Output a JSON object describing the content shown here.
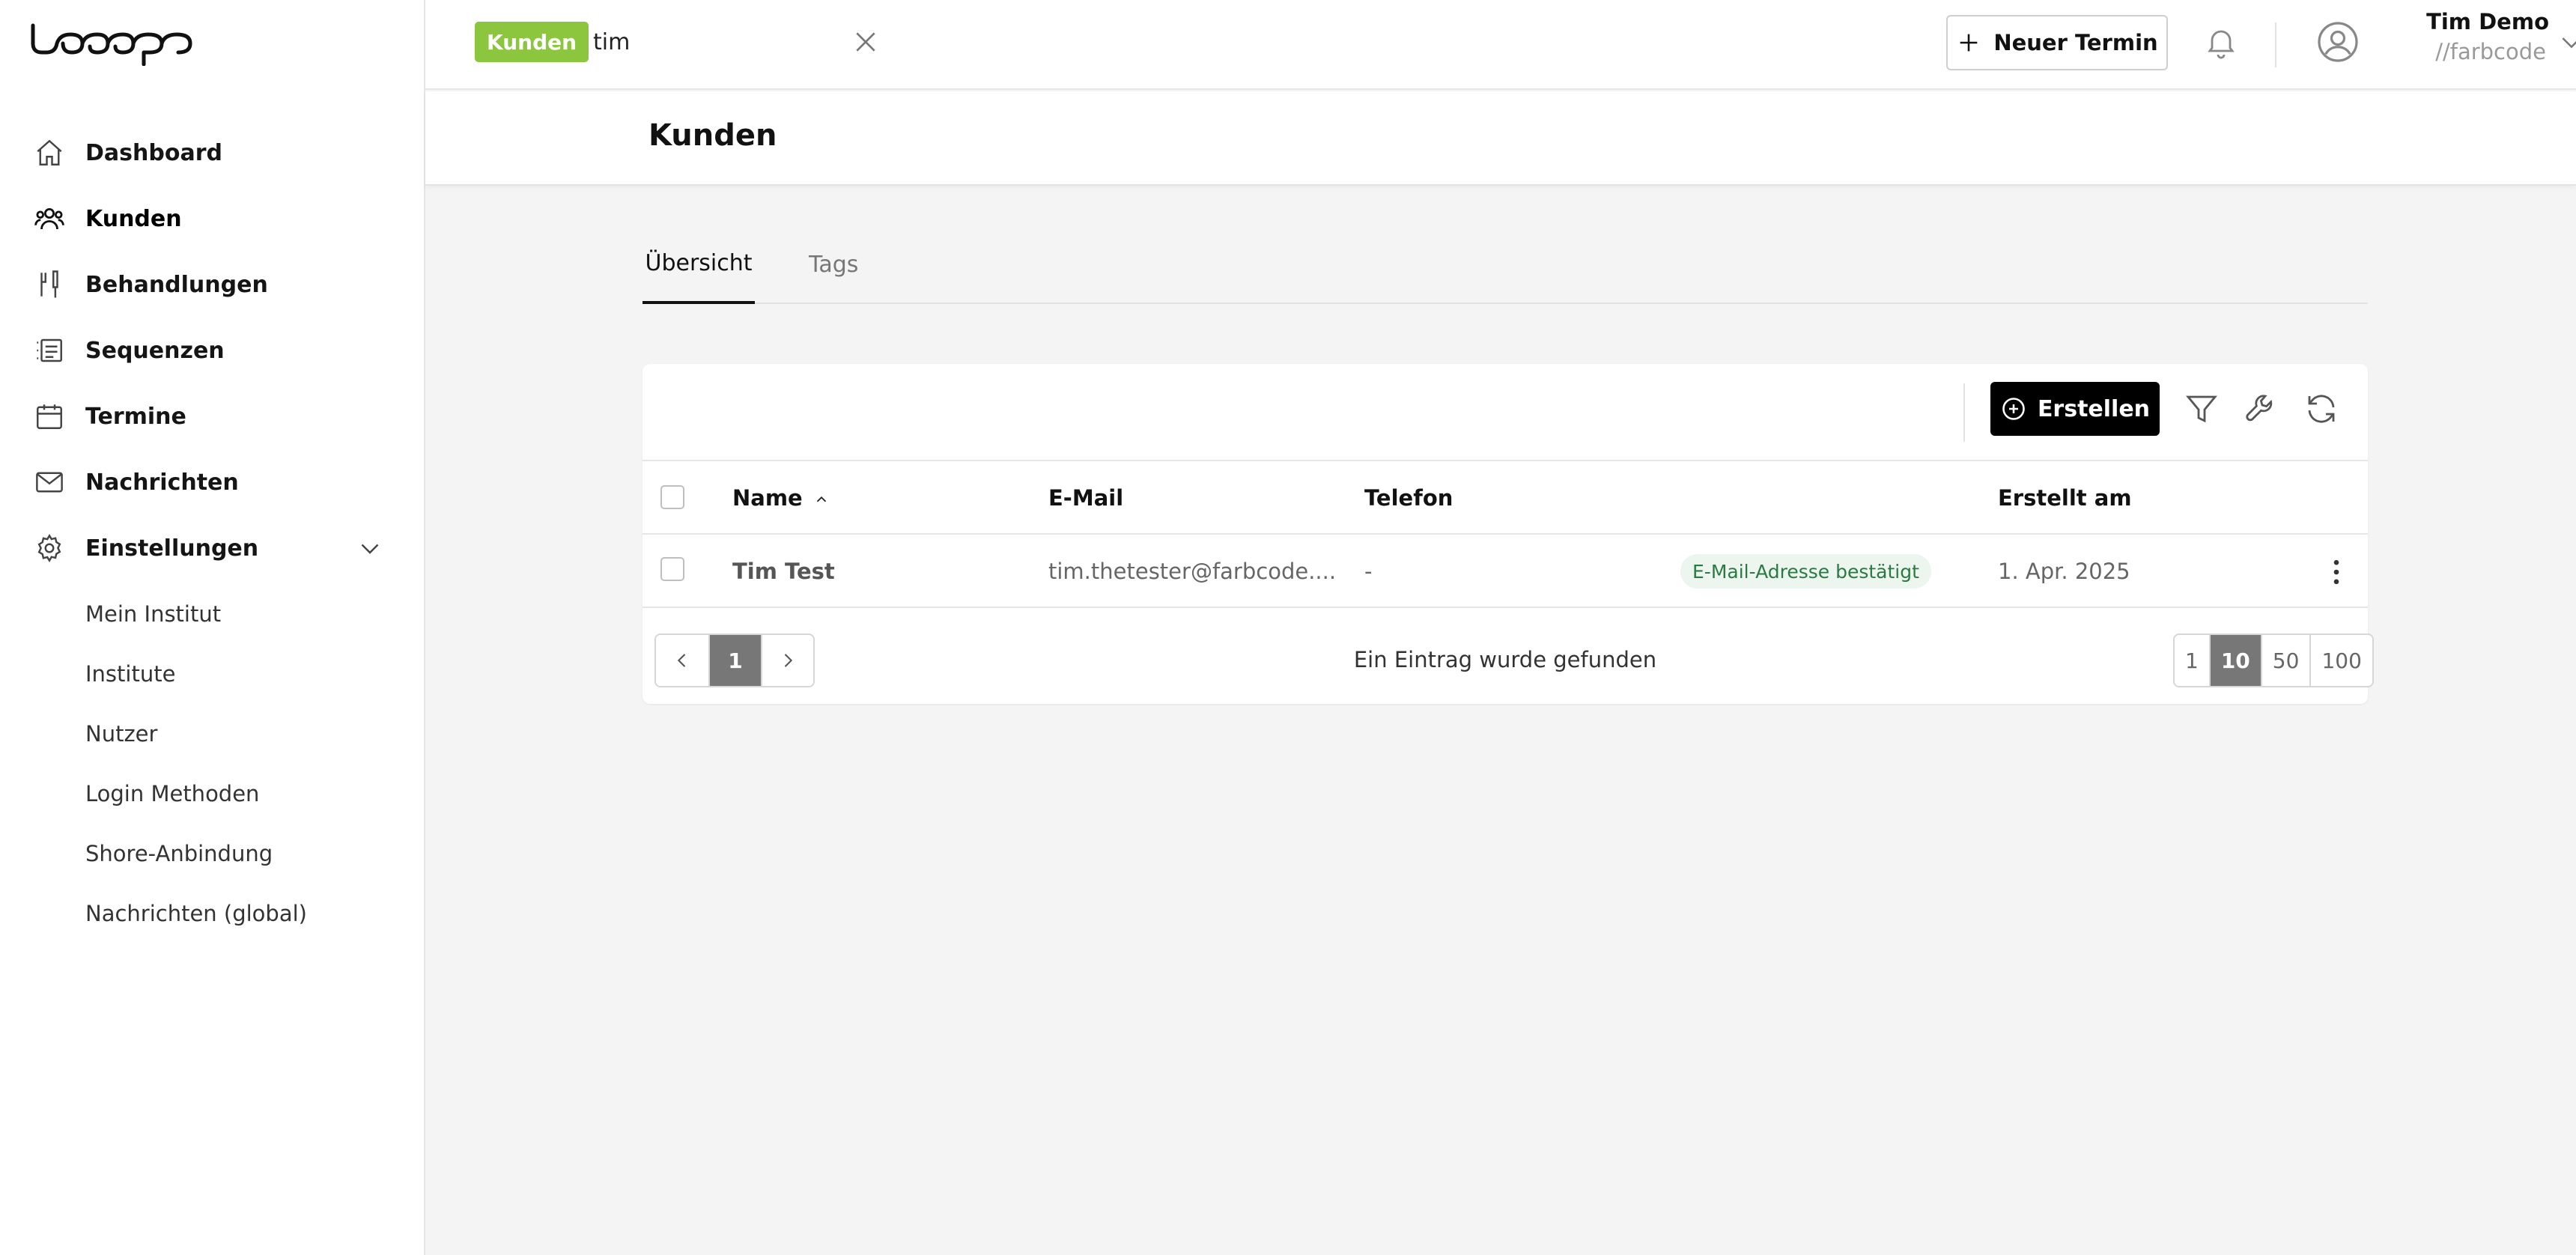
{
  "colors": {
    "accent_green": "#8cc63f",
    "primary_black": "#000000",
    "badge_bg": "#ecf5ee",
    "badge_text": "#2a7a43"
  },
  "sidebar": {
    "items": [
      {
        "label": "Dashboard",
        "icon": "home-icon"
      },
      {
        "label": "Kunden",
        "icon": "users-icon",
        "active": true
      },
      {
        "label": "Behandlungen",
        "icon": "treatment-tools-icon"
      },
      {
        "label": "Sequenzen",
        "icon": "list-icon"
      },
      {
        "label": "Termine",
        "icon": "calendar-icon"
      },
      {
        "label": "Nachrichten",
        "icon": "mail-icon"
      },
      {
        "label": "Einstellungen",
        "icon": "gear-icon",
        "expanded": true
      }
    ],
    "settings_sub": [
      "Mein Institut",
      "Institute",
      "Nutzer",
      "Login Methoden",
      "Shore-Anbindung",
      "Nachrichten (global)"
    ]
  },
  "topbar": {
    "search_chip": "Kunden",
    "search_value": "tim",
    "new_appointment_label": "Neuer Termin",
    "user_name": "Tim Demo",
    "user_org": "//farbcode"
  },
  "page": {
    "title": "Kunden",
    "tabs": [
      {
        "label": "Übersicht",
        "active": true
      },
      {
        "label": "Tags"
      }
    ]
  },
  "table": {
    "create_label": "Erstellen",
    "columns": {
      "name": "Name",
      "email": "E-Mail",
      "phone": "Telefon",
      "created": "Erstellt am"
    },
    "rows": [
      {
        "name": "Tim Test",
        "email": "tim.thetester@farbcode....",
        "phone": "-",
        "status": "E-Mail-Adresse bestätigt",
        "created": "1. Apr. 2025"
      }
    ],
    "pagination": {
      "current_page": "1",
      "summary": "Ein Eintrag wurde gefunden",
      "page_sizes": [
        "1",
        "10",
        "50",
        "100"
      ],
      "active_size": "10"
    }
  }
}
